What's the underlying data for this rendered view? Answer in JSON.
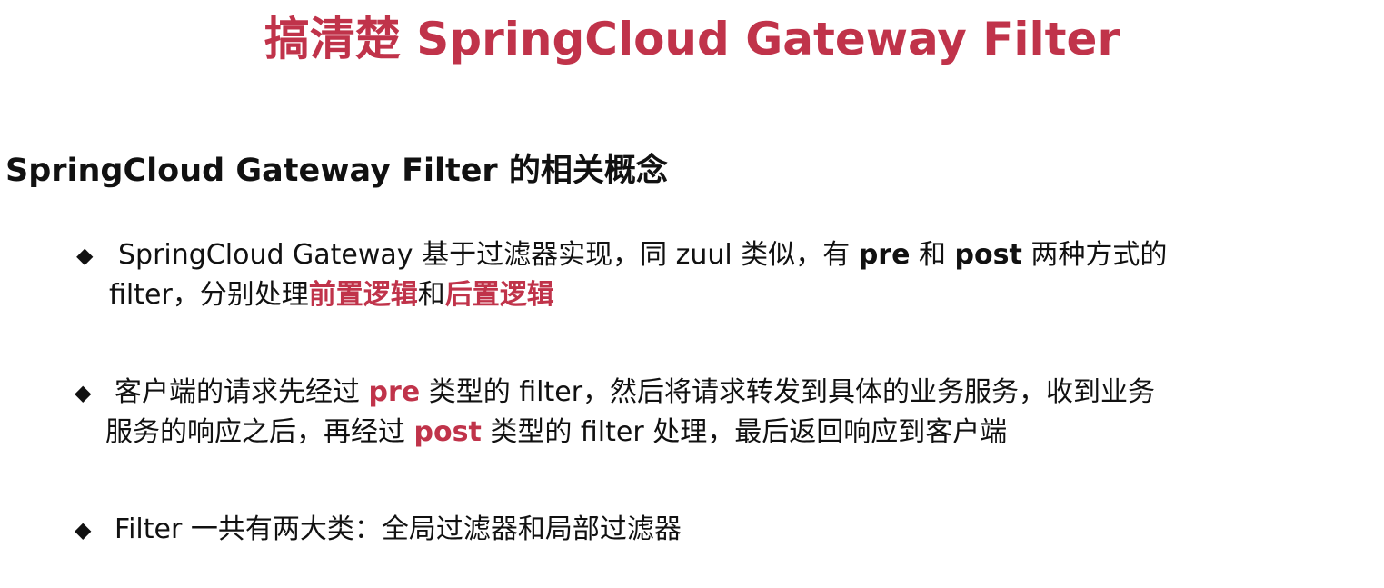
{
  "title": "搞清楚 SpringCloud Gateway Filter",
  "heading": "SpringCloud Gateway Filter 的相关概念",
  "accent_color": "#c0334a",
  "bullet_glyph": "◆",
  "bullets": [
    {
      "line1": {
        "t1": "SpringCloud Gateway 基于过滤器实现，同 zuul 类似，有 ",
        "b1": "pre",
        "t2": " 和 ",
        "b2": "post",
        "t3": " 两种方式的"
      },
      "line2": {
        "t1": "filter，分别处理",
        "r1": "前置逻辑",
        "t2": "和",
        "r2": "后置逻辑"
      }
    },
    {
      "line1": {
        "t1": "客户端的请求先经过 ",
        "r1": "pre",
        "t2": " 类型的 filter，然后将请求转发到具体的业务服务，收到业务"
      },
      "line2": {
        "t1": "服务的响应之后，再经过 ",
        "r1": "post",
        "t2": " 类型的 filter 处理，最后返回响应到客户端"
      }
    },
    {
      "line1": {
        "t1": "Filter 一共有两大类：全局过滤器和局部过滤器"
      }
    }
  ]
}
